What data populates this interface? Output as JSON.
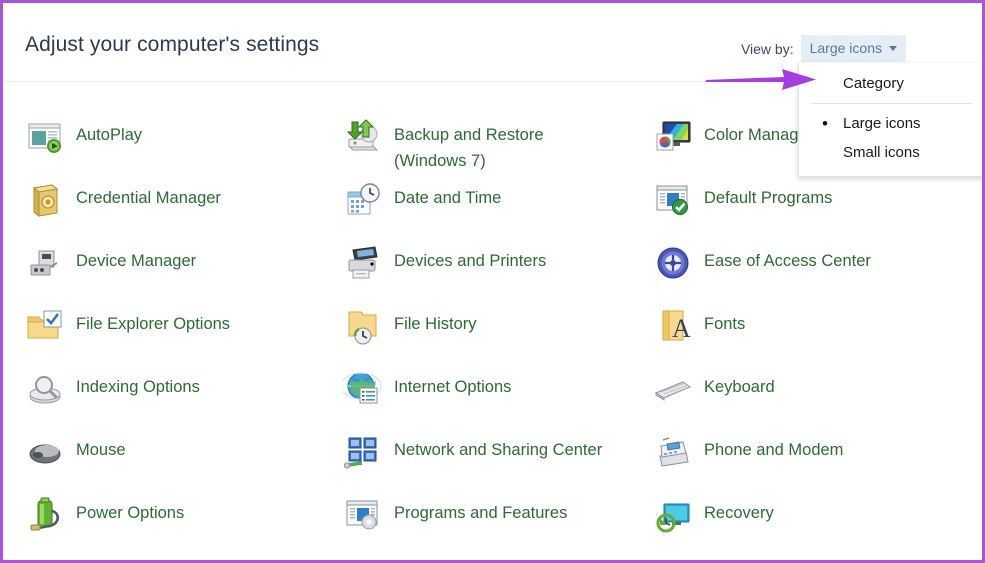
{
  "window": {
    "title": "Adjust your computer's settings",
    "accent_border_color": "#a855d8",
    "label_color": "#2c6b31",
    "title_color": "#2b3a52"
  },
  "header": {
    "view_by_label": "View by:",
    "view_by_value": "Large icons",
    "caret_icon": "chevron-down-icon"
  },
  "dropdown": {
    "open": true,
    "items": [
      {
        "label": "Category",
        "selected": false,
        "bullet": ""
      },
      {
        "label": "Large icons",
        "selected": true,
        "bullet": "•"
      },
      {
        "label": "Small icons",
        "selected": false,
        "bullet": ""
      }
    ]
  },
  "annotation": {
    "arrow_color": "#a33ee0",
    "points_to": "Category"
  },
  "items": [
    {
      "label": "AutoPlay",
      "icon": "autoplay-icon",
      "col": 1,
      "row": 0
    },
    {
      "label": "Credential Manager",
      "icon": "credential-manager-icon",
      "col": 1,
      "row": 1
    },
    {
      "label": "Device Manager",
      "icon": "device-manager-icon",
      "col": 1,
      "row": 2
    },
    {
      "label": "File Explorer Options",
      "icon": "file-explorer-options-icon",
      "col": 1,
      "row": 3
    },
    {
      "label": "Indexing Options",
      "icon": "indexing-options-icon",
      "col": 1,
      "row": 4
    },
    {
      "label": "Mouse",
      "icon": "mouse-icon",
      "col": 1,
      "row": 5
    },
    {
      "label": "Power Options",
      "icon": "power-options-icon",
      "col": 1,
      "row": 6
    },
    {
      "label": "Backup and Restore (Windows 7)",
      "icon": "backup-restore-icon",
      "col": 2,
      "row": 0
    },
    {
      "label": "Date and Time",
      "icon": "date-time-icon",
      "col": 2,
      "row": 1
    },
    {
      "label": "Devices and Printers",
      "icon": "devices-printers-icon",
      "col": 2,
      "row": 2
    },
    {
      "label": "File History",
      "icon": "file-history-icon",
      "col": 2,
      "row": 3
    },
    {
      "label": "Internet Options",
      "icon": "internet-options-icon",
      "col": 2,
      "row": 4
    },
    {
      "label": "Network and Sharing Center",
      "icon": "network-sharing-icon",
      "col": 2,
      "row": 5
    },
    {
      "label": "Programs and Features",
      "icon": "programs-features-icon",
      "col": 2,
      "row": 6
    },
    {
      "label": "Color Management",
      "icon": "color-management-icon",
      "col": 3,
      "row": 0
    },
    {
      "label": "Default Programs",
      "icon": "default-programs-icon",
      "col": 3,
      "row": 1
    },
    {
      "label": "Ease of Access Center",
      "icon": "ease-of-access-icon",
      "col": 3,
      "row": 2
    },
    {
      "label": "Fonts",
      "icon": "fonts-icon",
      "col": 3,
      "row": 3
    },
    {
      "label": "Keyboard",
      "icon": "keyboard-icon",
      "col": 3,
      "row": 4
    },
    {
      "label": "Phone and Modem",
      "icon": "phone-modem-icon",
      "col": 3,
      "row": 5
    },
    {
      "label": "Recovery",
      "icon": "recovery-icon",
      "col": 3,
      "row": 6
    }
  ]
}
